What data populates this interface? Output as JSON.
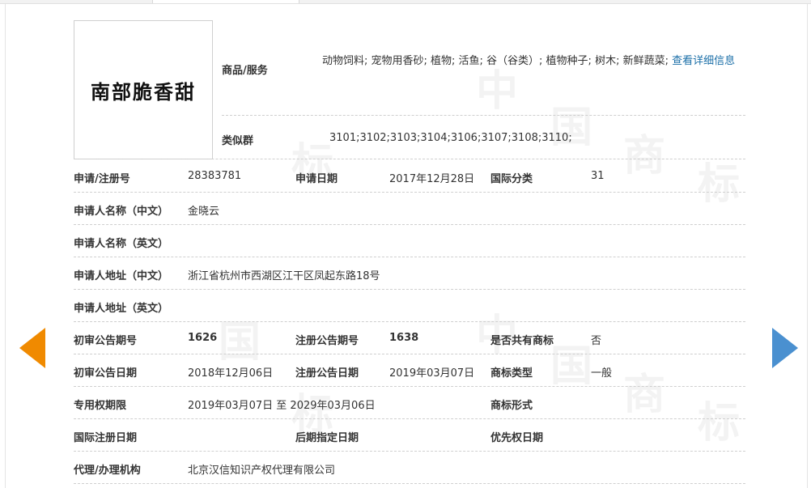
{
  "watermark": {
    "chars": [
      "中",
      "国",
      "商",
      "标"
    ]
  },
  "logo": {
    "text": "南部脆香甜"
  },
  "goods": {
    "label": "商品/服务",
    "items": "动物饲料; 宠物用香砂; 植物; 活鱼; 谷（谷类）; 植物种子; 树木; 新鲜蔬菜;",
    "detail_link": "查看详细信息"
  },
  "similar_group": {
    "label": "类似群",
    "value": "3101;3102;3103;3104;3106;3107;3108;3110;"
  },
  "fields": {
    "reg_no": {
      "label": "申请/注册号",
      "value": "28383781"
    },
    "apply_date": {
      "label": "申请日期",
      "value": "2017年12月28日"
    },
    "intl_class": {
      "label": "国际分类",
      "value": "31"
    },
    "applicant_cn": {
      "label": "申请人名称（中文）",
      "value": "金晓云"
    },
    "applicant_en": {
      "label": "申请人名称（英文）",
      "value": ""
    },
    "address_cn": {
      "label": "申请人地址（中文）",
      "value": "浙江省杭州市西湖区江干区凤起东路18号"
    },
    "address_en": {
      "label": "申请人地址（英文）",
      "value": ""
    },
    "prelim_pub_no": {
      "label": "初审公告期号",
      "value": "1626"
    },
    "reg_pub_no": {
      "label": "注册公告期号",
      "value": "1638"
    },
    "shared_mark": {
      "label": "是否共有商标",
      "value": "否"
    },
    "prelim_pub_date": {
      "label": "初审公告日期",
      "value": "2018年12月06日"
    },
    "reg_pub_date": {
      "label": "注册公告日期",
      "value": "2019年03月07日"
    },
    "mark_type": {
      "label": "商标类型",
      "value": "一般"
    },
    "exclusive_period": {
      "label": "专用权期限",
      "value": "2019年03月07日 至 2029年03月06日"
    },
    "mark_form": {
      "label": "商标形式",
      "value": ""
    },
    "intl_reg_date": {
      "label": "国际注册日期",
      "value": ""
    },
    "later_designation_date": {
      "label": "后期指定日期",
      "value": ""
    },
    "priority_date": {
      "label": "优先权日期",
      "value": ""
    },
    "agency": {
      "label": "代理/办理机构",
      "value": "北京汉信知识产权代理有限公司"
    }
  },
  "colors": {
    "link": "#1b6fa8",
    "prev_arrow": "#f08a00",
    "next_arrow": "#4a90d0"
  }
}
